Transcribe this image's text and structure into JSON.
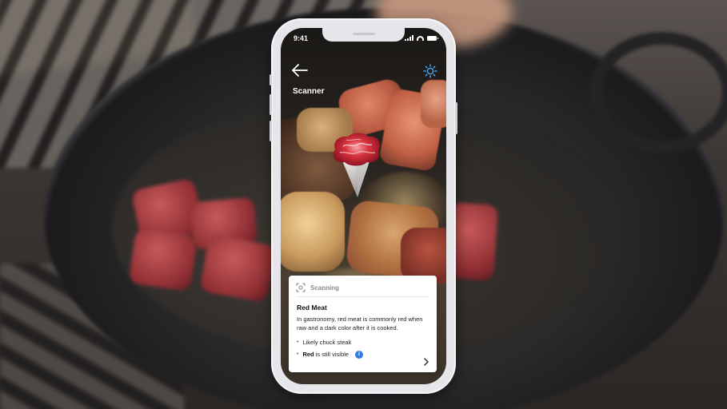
{
  "status_bar": {
    "time": "9:41"
  },
  "header": {
    "title": "Scanner",
    "back_icon": "arrow-left-icon",
    "settings_icon": "gear-icon"
  },
  "scan_card": {
    "status_label": "Scanning",
    "status_icon": "scan-target-icon",
    "title": "Red Meat",
    "description": "In gastronomy, red meat is commonly red when raw and a dark color after it is cooked.",
    "bullets": [
      {
        "text": "Likely chuck steak"
      },
      {
        "bold": "Red",
        "text": " is still visible",
        "badge": "i"
      }
    ],
    "more_icon": "chevron-right-icon"
  },
  "colors": {
    "accent": "#2f7de1",
    "card_bg": "#ffffff",
    "marker_red": "#c9233a"
  }
}
